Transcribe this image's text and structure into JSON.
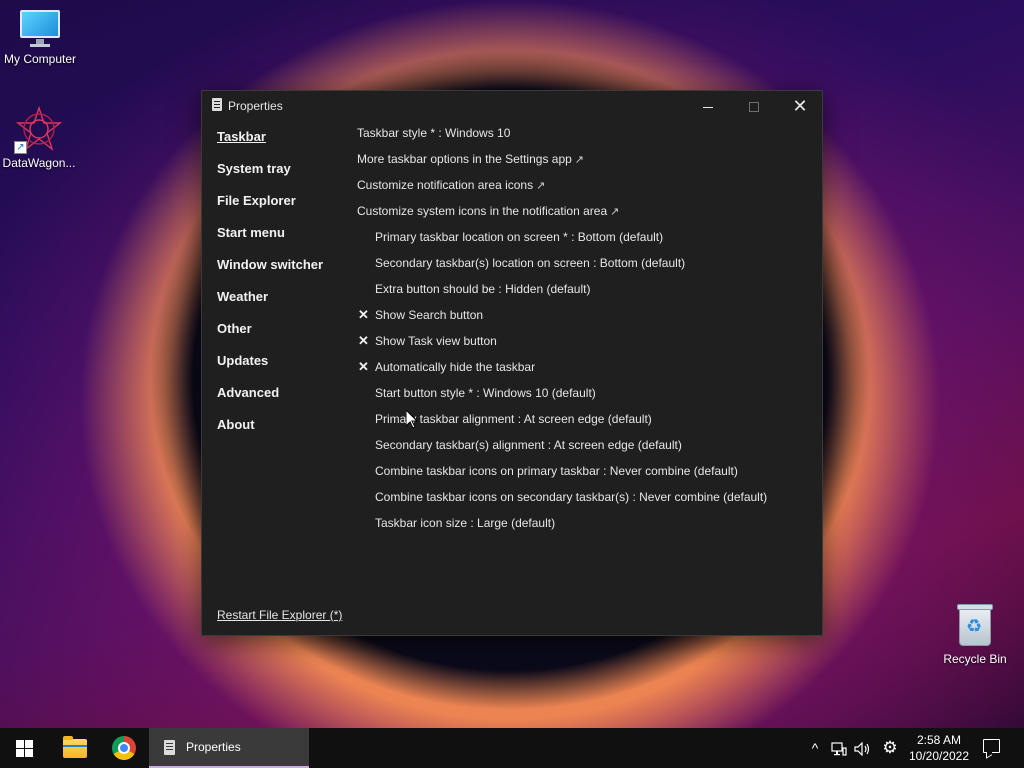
{
  "desktop": {
    "icons": [
      {
        "label": "My Computer",
        "icon": "monitor-icon"
      },
      {
        "label": "DataWagon...",
        "icon": "datawagon-icon"
      },
      {
        "label": "Recycle Bin",
        "icon": "recycle-bin-icon"
      }
    ]
  },
  "window": {
    "title": "Properties",
    "controls": {
      "minimize": "minimize-icon",
      "maximize": "maximize-icon",
      "close": "✕"
    },
    "sidebar": {
      "items": [
        {
          "label": "Taskbar",
          "active": true
        },
        {
          "label": "System tray"
        },
        {
          "label": "File Explorer"
        },
        {
          "label": "Start menu"
        },
        {
          "label": "Window switcher"
        },
        {
          "label": "Weather"
        },
        {
          "label": "Other"
        },
        {
          "label": "Updates"
        },
        {
          "label": "Advanced"
        },
        {
          "label": "About"
        }
      ]
    },
    "settings": [
      {
        "label": "Taskbar style * : Windows 10"
      },
      {
        "label": "More taskbar options in the Settings app",
        "external": "↗"
      },
      {
        "label": "Customize notification area icons",
        "external": "↗"
      },
      {
        "label": "Customize system icons in the notification area",
        "external": "↗"
      },
      {
        "label": "Primary taskbar location on screen * : Bottom (default)"
      },
      {
        "label": "Secondary taskbar(s) location on screen : Bottom (default)"
      },
      {
        "label": "Extra button should be : Hidden (default)"
      },
      {
        "label": "Show Search button",
        "mark": "✕"
      },
      {
        "label": "Show Task view button",
        "mark": "✕"
      },
      {
        "label": "Automatically hide the taskbar",
        "mark": "✕"
      },
      {
        "label": "Start button style * : Windows 10 (default)"
      },
      {
        "label": "Primary taskbar alignment : At screen edge (default)"
      },
      {
        "label": "Secondary taskbar(s) alignment : At screen edge (default)"
      },
      {
        "label": "Combine taskbar icons on primary taskbar : Never combine (default)"
      },
      {
        "label": "Combine taskbar icons on secondary taskbar(s) : Never combine (default)"
      },
      {
        "label": "Taskbar icon size : Large (default)"
      }
    ],
    "footer_link": "Restart File Explorer (*)"
  },
  "taskbar": {
    "start_icon": "windows-logo-icon",
    "pinned": [
      "file-explorer-icon",
      "chrome-icon"
    ],
    "active_task": {
      "label": "Properties"
    },
    "tray": {
      "chevron": "^",
      "network": "network-icon",
      "volume": "volume-icon",
      "settings": "⚙"
    },
    "clock": {
      "time": "2:58 AM",
      "date": "10/20/2022"
    },
    "notifications_icon": "notification-icon"
  }
}
